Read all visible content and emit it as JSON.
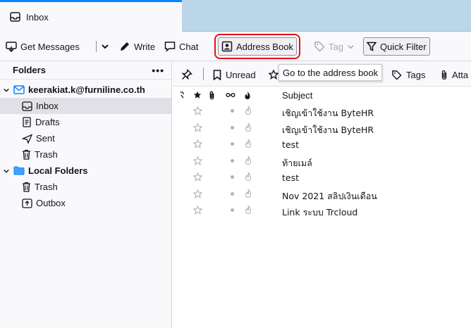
{
  "tab": {
    "label": "Inbox"
  },
  "toolbar": {
    "get_messages": "Get Messages",
    "write": "Write",
    "chat": "Chat",
    "address_book": "Address Book",
    "tag": "Tag",
    "quick_filter": "Quick Filter"
  },
  "folder_pane": {
    "header": "Folders",
    "menu": "•••",
    "account": "keerakiat.k@furniline.co.th",
    "account_folders": [
      {
        "name": "Inbox",
        "icon": "inbox-icon",
        "selected": true
      },
      {
        "name": "Drafts",
        "icon": "drafts-icon",
        "selected": false
      },
      {
        "name": "Sent",
        "icon": "sent-icon",
        "selected": false
      },
      {
        "name": "Trash",
        "icon": "trash-icon",
        "selected": false
      }
    ],
    "local_folders_label": "Local Folders",
    "local_folders": [
      {
        "name": "Trash",
        "icon": "trash-icon"
      },
      {
        "name": "Outbox",
        "icon": "outbox-icon"
      }
    ]
  },
  "quick_filter": {
    "unread": "Unread",
    "tags": "Tags",
    "attachment": "Atta"
  },
  "tooltip": "Go to the address book",
  "columns": {
    "subject": "Subject"
  },
  "messages": [
    {
      "subject": "เชิญเข้าใช้งาน ByteHR"
    },
    {
      "subject": "เชิญเข้าใช้งาน ByteHR"
    },
    {
      "subject": "test"
    },
    {
      "subject": "ท้ายเมล์"
    },
    {
      "subject": "test"
    },
    {
      "subject": "Nov 2021 สลิปเงินเดือน"
    },
    {
      "subject": "Link ระบบ Trcloud"
    }
  ]
}
